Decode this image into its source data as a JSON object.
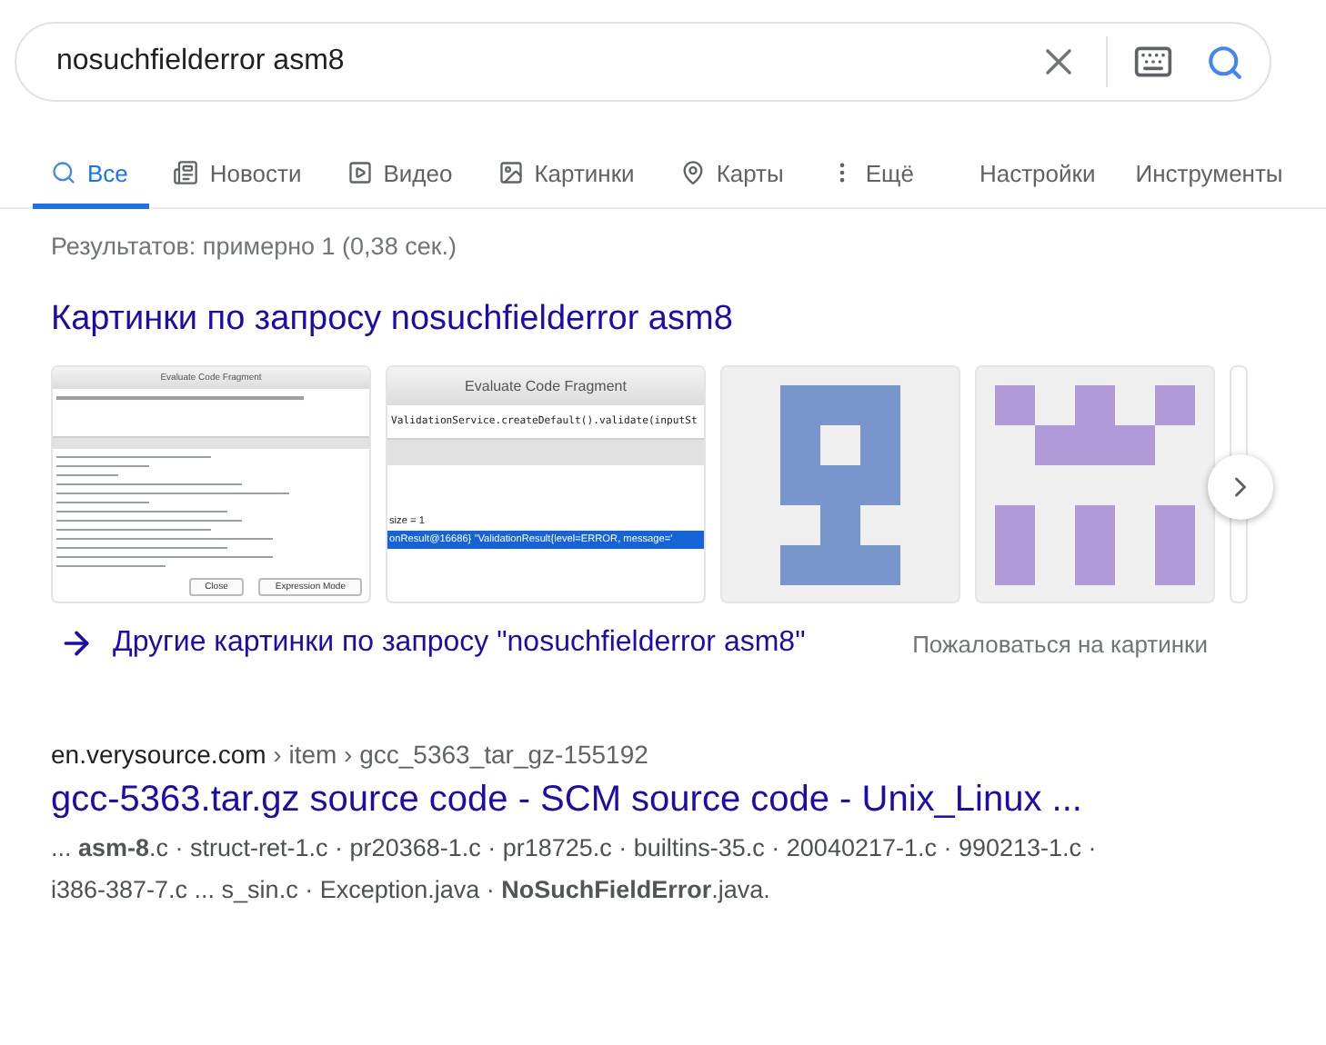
{
  "search": {
    "value": "nosuchfielderror asm8"
  },
  "tabs": [
    {
      "label": "Все",
      "selected": true
    },
    {
      "label": "Новости",
      "selected": false
    },
    {
      "label": "Видео",
      "selected": false
    },
    {
      "label": "Картинки",
      "selected": false
    },
    {
      "label": "Карты",
      "selected": false
    },
    {
      "label": "Ещё",
      "selected": false
    }
  ],
  "tools": [
    "Настройки",
    "Инструменты"
  ],
  "stats": "Результатов: примерно 1 (0,38 сек.)",
  "images": {
    "heading": "Картинки по запросу nosuchfielderror asm8",
    "thumbnails": [
      {
        "kind": "code-window",
        "title": "Evaluate Code Fragment",
        "buttons": [
          "Close",
          "Expression Mode"
        ]
      },
      {
        "kind": "code-window",
        "title": "Evaluate Code Fragment",
        "expression": "ValidationService.createDefault().validate(inputSt",
        "results": [
          {
            "text": "size = 1",
            "selected": false
          },
          {
            "text": "onResult@16686} \"ValidationResult{level=ERROR, message='",
            "selected": true
          }
        ]
      },
      {
        "kind": "identicon",
        "color": "#7896cc"
      },
      {
        "kind": "identicon",
        "color": "#b09ad8"
      },
      {
        "kind": "partial"
      }
    ],
    "more_link": "Другие картинки по запросу \"nosuchfielderror asm8\"",
    "report": "Пожаловаться на картинки"
  },
  "results": [
    {
      "site": "en.verysource.com",
      "path": " › item › gcc_5363_tar_gz-155192",
      "title": "gcc-5363.tar.gz source code - SCM source code - Unix_Linux ...",
      "snippet": [
        "... **asm-8**.c · struct-ret-1.c · pr20368-1.c · pr18725.c · builtins-35.c · 20040217-1.c · 990213-1.c ·",
        "i386-387-7.c ... s_sin.c · Exception.java · **NoSuchFieldError**.java."
      ]
    }
  ]
}
